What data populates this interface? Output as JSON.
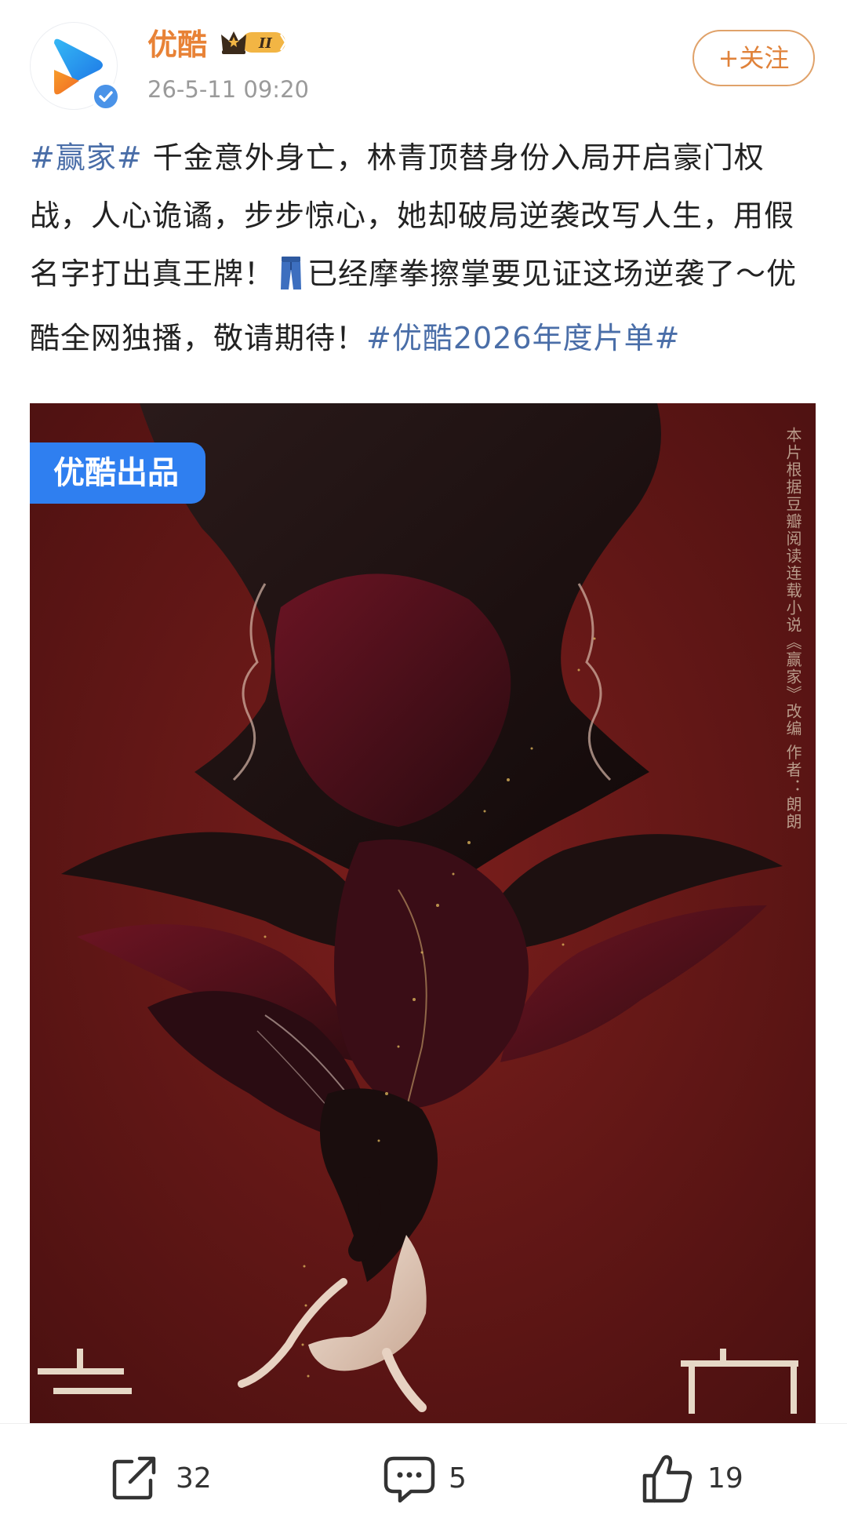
{
  "header": {
    "username": "优酷",
    "vip_level": "II",
    "time": "26-5-11 09:20",
    "follow_label": "+关注"
  },
  "post": {
    "topic_1": "#赢家#",
    "text_1": " 千金意外身亡，林青顶替身份入局开启豪门权战，人心诡谲，步步惊心，她却破局逆袭改写人生，用假名字打出真王牌！",
    "text_2": "已经摩拳擦掌要见证这场逆袭了～优酷全网独播，敬请期待！",
    "topic_2": "#优酷2026年度片单#"
  },
  "poster": {
    "badge": "优酷出品",
    "side_note": "本片根据豆瓣阅读连载小说《赢家》改编 作者：朗朗"
  },
  "actions": {
    "repost_count": "32",
    "comment_count": "5",
    "like_count": "19"
  },
  "colors": {
    "username": "#e88236",
    "topic": "#4a6ea8",
    "badge_blue": "#2f7ff0",
    "poster_bg": "#5a1414"
  },
  "icons": {
    "avatar": "youku-play-logo",
    "verified": "verified-check-icon",
    "repost": "share-icon",
    "comment": "comment-icon",
    "like": "thumbs-up-icon"
  }
}
